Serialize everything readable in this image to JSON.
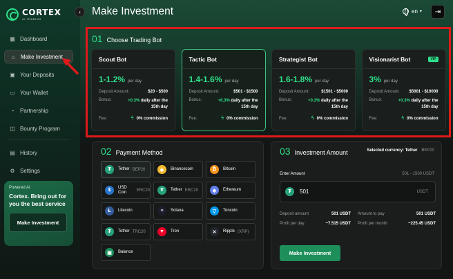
{
  "brand": {
    "name": "CORTEX",
    "sub": "AI TRADING"
  },
  "header": {
    "title": "Make Investment",
    "lang": "en"
  },
  "sidebar": {
    "items": [
      {
        "label": "Dashboard",
        "icon": "grid-icon"
      },
      {
        "label": "Make Investment",
        "icon": "investment-icon",
        "active": true
      },
      {
        "label": "Your Deposits",
        "icon": "deposit-icon"
      },
      {
        "label": "Your Wallet",
        "icon": "wallet-icon"
      },
      {
        "label": "Partnership",
        "icon": "partnership-icon"
      },
      {
        "label": "Bounty Program",
        "icon": "bounty-icon"
      },
      {
        "label": "History",
        "icon": "history-icon"
      },
      {
        "label": "Settings",
        "icon": "settings-icon"
      }
    ],
    "promo": {
      "tag": "Powered AI",
      "title": "Cortex. Bring out for you the best service",
      "button": "Make Investment"
    }
  },
  "section1": {
    "num": "01",
    "title": "Choose Trading Bot"
  },
  "bots": [
    {
      "name": "Scout Bot",
      "rate": "1-1.2%",
      "unit": "per day",
      "amount_label": "Deposit Amount:",
      "amount": "$20 - $500",
      "bonus_label": "Bonus:",
      "bonus_green": "+0.3%",
      "bonus_text": "daily after the",
      "bonus_line2": "15th day",
      "fee_label": "Fee:",
      "fee": "0% commission"
    },
    {
      "name": "Tactic Bot",
      "rate": "1.4-1.6%",
      "unit": "per day",
      "amount_label": "Deposit Amount:",
      "amount": "$501 - $1500",
      "bonus_label": "Bonus:",
      "bonus_green": "+0.3%",
      "bonus_text": "daily after the",
      "bonus_line2": "15th day",
      "fee_label": "Fee:",
      "fee": "0% commission",
      "active": true
    },
    {
      "name": "Strategist Bot",
      "rate": "1.6-1.8%",
      "unit": "per day",
      "amount_label": "Deposit Amount:",
      "amount": "$1501 - $5000",
      "bonus_label": "Bonus:",
      "bonus_green": "+0.3%",
      "bonus_text": "daily after the",
      "bonus_line2": "15th day",
      "fee_label": "Fee:",
      "fee": "0% commission"
    },
    {
      "name": "Visionarist Bot",
      "badge": "VIP",
      "rate": "3%",
      "unit": "per day",
      "amount_label": "Deposit Amount:",
      "amount": "$5001 - $10000",
      "bonus_label": "Bonus:",
      "bonus_green": "+0.3%",
      "bonus_text": "daily after the",
      "bonus_line2": "15th day",
      "fee_label": "Fee:",
      "fee": "0% commission"
    }
  ],
  "section2": {
    "num": "02",
    "title": "Payment Method"
  },
  "coins": [
    {
      "name": "Tether",
      "net": "BEP20",
      "color": "#26a17b",
      "glyph": "₮",
      "active": true
    },
    {
      "name": "Binancecoin",
      "net": "",
      "color": "#f3ba2f",
      "glyph": "◆"
    },
    {
      "name": "Bitcoin",
      "net": "",
      "color": "#f7931a",
      "glyph": "₿"
    },
    {
      "name": "USD Coin",
      "net": "ERC20",
      "color": "#2775ca",
      "glyph": "$"
    },
    {
      "name": "Tether",
      "net": "ERC20",
      "color": "#26a17b",
      "glyph": "₮"
    },
    {
      "name": "Ethereum",
      "net": "",
      "color": "#627eea",
      "glyph": "◆"
    },
    {
      "name": "Litecoin",
      "net": "",
      "color": "#345d9d",
      "glyph": "Ł"
    },
    {
      "name": "Solana",
      "net": "",
      "color": "#1c1c2a",
      "glyph": "≡"
    },
    {
      "name": "Toncoin",
      "net": "",
      "color": "#0098ea",
      "glyph": "▽"
    },
    {
      "name": "Tether",
      "net": "TRC20",
      "color": "#26a17b",
      "glyph": "₮"
    },
    {
      "name": "Tron",
      "net": "",
      "color": "#eb0029",
      "glyph": "▼"
    },
    {
      "name": "Ripple",
      "net": "(XRP)",
      "color": "#23292f",
      "glyph": "✕"
    },
    {
      "name": "Balance",
      "net": "",
      "color": "#1e8f5b",
      "glyph": "▣"
    }
  ],
  "section3": {
    "num": "03",
    "title": "Investment Amount",
    "currency_label": "Selected currency:",
    "currency": "Tether",
    "currency_net": "BEP20"
  },
  "amount": {
    "label": "Enter Amount",
    "range": "501 - 1500 USDT",
    "value": "501",
    "unit": "USDT"
  },
  "stats": {
    "deposit_label": "Deposit amount",
    "deposit": "501 USDT",
    "pay_label": "Amount to pay",
    "pay": "501 USDT",
    "day_label": "Profit per day",
    "day": "~7.515 USDT",
    "month_label": "Profit per month",
    "month": "~225.45 USDT"
  },
  "submit": "Make Investment",
  "colors": {
    "accent": "#2ee08b",
    "highlight": "#e01a1a",
    "button": "#1e8f5b"
  }
}
